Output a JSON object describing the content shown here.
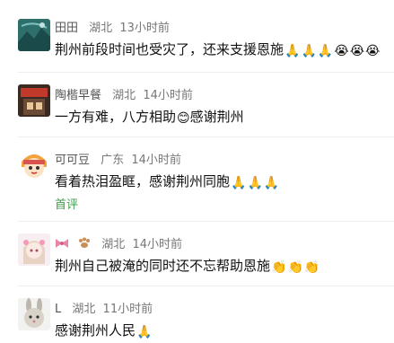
{
  "comments": [
    {
      "avatar_icon": "mountain-landscape-avatar",
      "name": "田田",
      "location": "湖北",
      "time": "13小时前",
      "text": "荆州前段时间也受灾了，还来支援恩施",
      "emojis": [
        "🙏",
        "🙏",
        "🙏",
        "😭",
        "😭",
        "😭"
      ]
    },
    {
      "avatar_icon": "breakfast-shop-avatar",
      "name": "陶楷早餐",
      "location": "湖北",
      "time": "14小时前",
      "text_before": "一方有难，八方相助",
      "emoji_mid": "😊",
      "text_after": "感谢荆州"
    },
    {
      "avatar_icon": "cartoon-girl-avatar",
      "name": "可可豆",
      "location": "广东",
      "time": "14小时前",
      "text": "看着热泪盈眶，感谢荆州同胞",
      "emojis": [
        "🙏",
        "🙏",
        "🙏"
      ],
      "reply_label": "首评"
    },
    {
      "avatar_icon": "anime-girl-avatar",
      "name_icons": [
        "bow-icon",
        "paw-icon"
      ],
      "location": "湖北",
      "time": "14小时前",
      "text": "荆州自己被淹的同时还不忘帮助恩施",
      "emojis": [
        "👏",
        "👏",
        "👏"
      ]
    },
    {
      "avatar_icon": "bunny-avatar",
      "name": "L",
      "location": "湖北",
      "time": "11小时前",
      "text": "感谢荆州人民",
      "emojis": [
        "🙏"
      ]
    }
  ]
}
